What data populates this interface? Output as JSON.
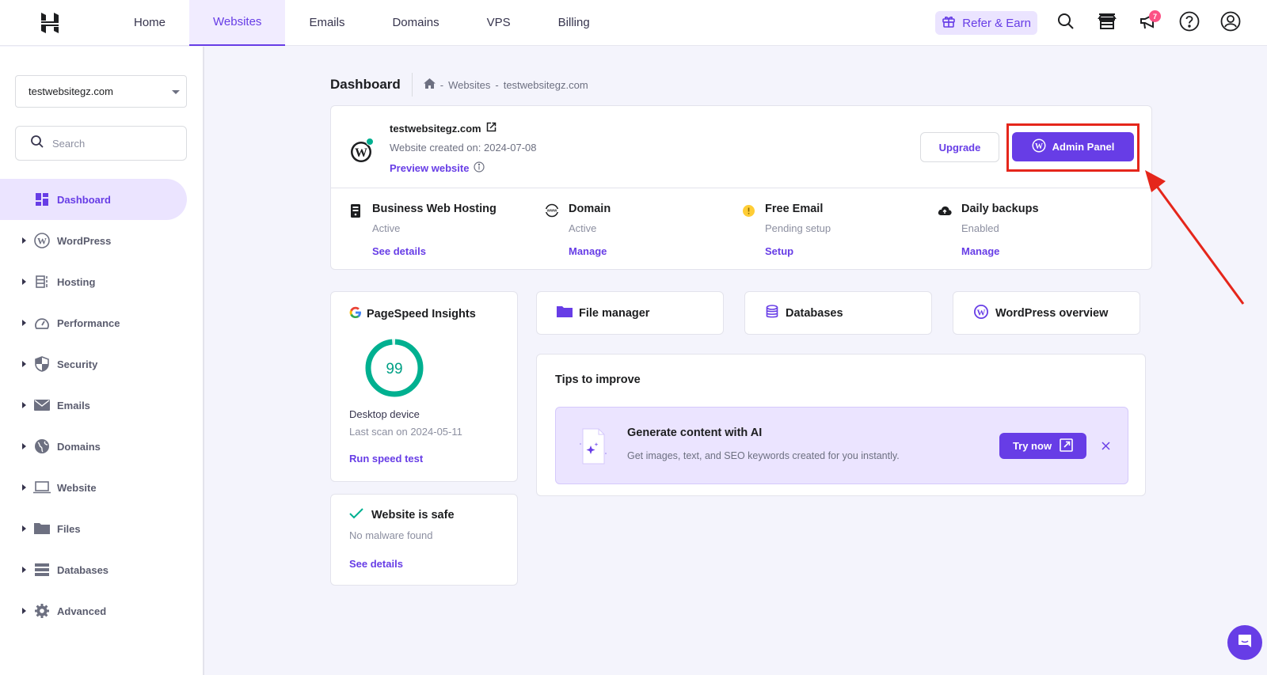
{
  "topbar": {
    "logo": "hostinger-logo",
    "nav": [
      {
        "label": "Home",
        "active": false
      },
      {
        "label": "Websites",
        "active": true
      },
      {
        "label": "Emails",
        "active": false
      },
      {
        "label": "Domains",
        "active": false
      },
      {
        "label": "VPS",
        "active": false
      },
      {
        "label": "Billing",
        "active": false
      }
    ],
    "refer_label": "Refer & Earn",
    "notification_count": "7",
    "icons": [
      "gift-icon",
      "search-icon",
      "store-icon",
      "megaphone-icon",
      "help-icon",
      "account-icon"
    ]
  },
  "sidebar": {
    "site_selector": "testwebsitegz.com",
    "search_placeholder": "Search",
    "items": [
      {
        "label": "Dashboard",
        "icon": "dashboard-icon",
        "active": true,
        "expandable": false
      },
      {
        "label": "WordPress",
        "icon": "wordpress-icon",
        "active": false,
        "expandable": true
      },
      {
        "label": "Hosting",
        "icon": "hosting-icon",
        "active": false,
        "expandable": true
      },
      {
        "label": "Performance",
        "icon": "speedometer-icon",
        "active": false,
        "expandable": true
      },
      {
        "label": "Security",
        "icon": "shield-icon",
        "active": false,
        "expandable": true
      },
      {
        "label": "Emails",
        "icon": "mail-icon",
        "active": false,
        "expandable": true
      },
      {
        "label": "Domains",
        "icon": "globe-icon",
        "active": false,
        "expandable": true
      },
      {
        "label": "Website",
        "icon": "laptop-icon",
        "active": false,
        "expandable": true
      },
      {
        "label": "Files",
        "icon": "folder-icon",
        "active": false,
        "expandable": true
      },
      {
        "label": "Databases",
        "icon": "database-icon",
        "active": false,
        "expandable": true
      },
      {
        "label": "Advanced",
        "icon": "gear-icon",
        "active": false,
        "expandable": true
      }
    ]
  },
  "page": {
    "title": "Dashboard",
    "breadcrumb": [
      "Websites",
      "testwebsitegz.com"
    ],
    "breadcrumb_sep": "-"
  },
  "site_card": {
    "domain": "testwebsitegz.com",
    "created": "Website created on: 2024-07-08",
    "preview_label": "Preview website",
    "upgrade_label": "Upgrade",
    "admin_label": "Admin Panel",
    "services": [
      {
        "title": "Business Web Hosting",
        "status": "Active",
        "link": "See details",
        "icon": "hosting-icon"
      },
      {
        "title": "Domain",
        "status": "Active",
        "link": "Manage",
        "icon": "www-icon"
      },
      {
        "title": "Free Email",
        "status": "Pending setup",
        "link": "Setup",
        "icon": "warning-icon"
      },
      {
        "title": "Daily backups",
        "status": "Enabled",
        "link": "Manage",
        "icon": "cloud-upload-icon"
      }
    ]
  },
  "pagespeed": {
    "title": "PageSpeed Insights",
    "score": "99",
    "score_value": 99,
    "device": "Desktop device",
    "last_scan": "Last scan on 2024-05-11",
    "link": "Run speed test"
  },
  "safety": {
    "title": "Website is safe",
    "subtitle": "No malware found",
    "link": "See details"
  },
  "quick_links": [
    {
      "label": "File manager",
      "icon": "folder-icon"
    },
    {
      "label": "Databases",
      "icon": "database-icon"
    },
    {
      "label": "WordPress overview",
      "icon": "wordpress-icon"
    }
  ],
  "tips": {
    "title": "Tips to improve",
    "ai_title": "Generate content with AI",
    "ai_subtitle": "Get images, text, and SEO keywords created for you instantly.",
    "try_label": "Try now"
  },
  "colors": {
    "accent": "#673de6",
    "accent_light": "#ebe4ff",
    "success": "#00b090",
    "warning": "#ffcd35",
    "annotation": "#e5261b"
  }
}
